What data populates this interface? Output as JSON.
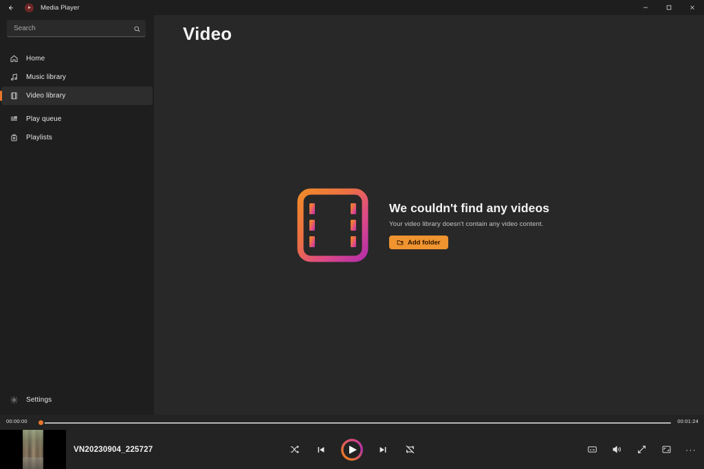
{
  "titlebar": {
    "back_label": "←",
    "app_name": "Media Player",
    "logo_icon": "media-player-logo-icon",
    "minimize_label": "—",
    "maximize_label": "◻",
    "close_label": "✕"
  },
  "search": {
    "placeholder": "Search",
    "value": "",
    "icon": "search-icon"
  },
  "sidebar": {
    "items": [
      {
        "label": "Home",
        "icon": "home-icon",
        "selected": false
      },
      {
        "label": "Music library",
        "icon": "music-note-icon",
        "selected": false
      },
      {
        "label": "Video library",
        "icon": "video-library-icon",
        "selected": true
      },
      {
        "label": "Play queue",
        "icon": "play-queue-icon",
        "selected": false
      },
      {
        "label": "Playlists",
        "icon": "playlists-icon",
        "selected": false
      }
    ],
    "settings": {
      "label": "Settings",
      "icon": "gear-icon"
    }
  },
  "main": {
    "page_title": "Video",
    "empty_state": {
      "icon": "film-strip-icon",
      "heading": "We couldn't find any videos",
      "description": "Your video library doesn't contain any video content.",
      "button_label": "Add folder",
      "button_icon": "add-folder-icon"
    }
  },
  "player": {
    "current_time": "00:00:00",
    "duration": "00:01:24",
    "progress_percent": 0,
    "now_playing": {
      "title": "VN20230904_225727",
      "thumbnail": "video-thumbnail"
    },
    "transport": [
      {
        "name": "shuffle-button",
        "icon": "shuffle-icon"
      },
      {
        "name": "previous-button",
        "icon": "previous-track-icon"
      },
      {
        "name": "play-button",
        "icon": "play-icon"
      },
      {
        "name": "next-button",
        "icon": "next-track-icon"
      },
      {
        "name": "repeat-button",
        "icon": "repeat-off-icon"
      }
    ],
    "right_controls": [
      {
        "name": "captions-button",
        "icon": "captions-icon"
      },
      {
        "name": "volume-button",
        "icon": "volume-icon"
      },
      {
        "name": "fullscreen-button",
        "icon": "fullscreen-icon"
      },
      {
        "name": "miniplayer-button",
        "icon": "miniplayer-icon"
      },
      {
        "name": "more-options-button",
        "icon": "more-horizontal-icon",
        "label": "···"
      }
    ]
  },
  "colors": {
    "accent_orange": "#e8762c",
    "accent_magenta": "#b52fa8",
    "button_orange": "#f0942f",
    "sidebar_bg": "#1e1e1e",
    "main_bg": "#282828",
    "player_bg": "#232323"
  }
}
